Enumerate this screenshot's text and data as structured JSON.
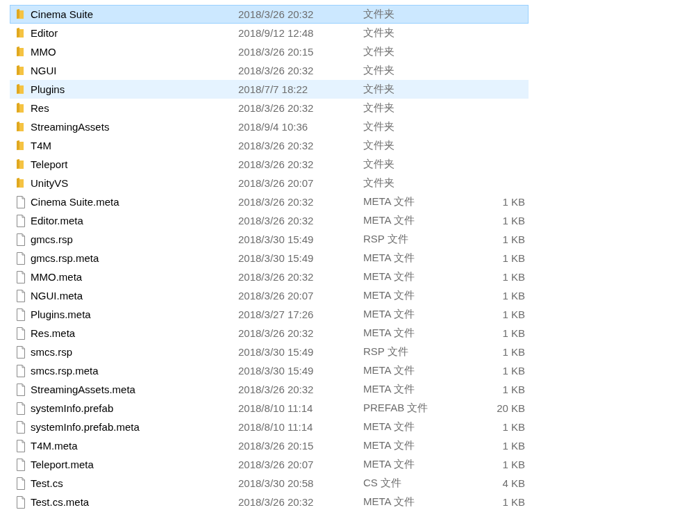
{
  "files": [
    {
      "kind": "folder",
      "name": "Cinema Suite",
      "modified": "2018/3/26 20:32",
      "type": "文件夹",
      "selected": true,
      "hovered": false
    },
    {
      "kind": "folder",
      "name": "Editor",
      "modified": "2018/9/12 12:48",
      "type": "文件夹",
      "selected": false,
      "hovered": false
    },
    {
      "kind": "folder",
      "name": "MMO",
      "modified": "2018/3/26 20:15",
      "type": "文件夹",
      "selected": false,
      "hovered": false
    },
    {
      "kind": "folder",
      "name": "NGUI",
      "modified": "2018/3/26 20:32",
      "type": "文件夹",
      "selected": false,
      "hovered": false
    },
    {
      "kind": "folder",
      "name": "Plugins",
      "modified": "2018/7/7 18:22",
      "type": "文件夹",
      "selected": false,
      "hovered": true
    },
    {
      "kind": "folder",
      "name": "Res",
      "modified": "2018/3/26 20:32",
      "type": "文件夹",
      "selected": false,
      "hovered": false
    },
    {
      "kind": "folder",
      "name": "StreamingAssets",
      "modified": "2018/9/4 10:36",
      "type": "文件夹",
      "selected": false,
      "hovered": false
    },
    {
      "kind": "folder",
      "name": "T4M",
      "modified": "2018/3/26 20:32",
      "type": "文件夹",
      "selected": false,
      "hovered": false
    },
    {
      "kind": "folder",
      "name": "Teleport",
      "modified": "2018/3/26 20:32",
      "type": "文件夹",
      "selected": false,
      "hovered": false
    },
    {
      "kind": "folder",
      "name": "UnityVS",
      "modified": "2018/3/26 20:07",
      "type": "文件夹",
      "selected": false,
      "hovered": false
    },
    {
      "kind": "file",
      "name": "Cinema Suite.meta",
      "modified": "2018/3/26 20:32",
      "type": "META 文件",
      "size": "1 KB",
      "selected": false,
      "hovered": false
    },
    {
      "kind": "file",
      "name": "Editor.meta",
      "modified": "2018/3/26 20:32",
      "type": "META 文件",
      "size": "1 KB",
      "selected": false,
      "hovered": false
    },
    {
      "kind": "file",
      "name": "gmcs.rsp",
      "modified": "2018/3/30 15:49",
      "type": "RSP 文件",
      "size": "1 KB",
      "selected": false,
      "hovered": false
    },
    {
      "kind": "file",
      "name": "gmcs.rsp.meta",
      "modified": "2018/3/30 15:49",
      "type": "META 文件",
      "size": "1 KB",
      "selected": false,
      "hovered": false
    },
    {
      "kind": "file",
      "name": "MMO.meta",
      "modified": "2018/3/26 20:32",
      "type": "META 文件",
      "size": "1 KB",
      "selected": false,
      "hovered": false
    },
    {
      "kind": "file",
      "name": "NGUI.meta",
      "modified": "2018/3/26 20:07",
      "type": "META 文件",
      "size": "1 KB",
      "selected": false,
      "hovered": false
    },
    {
      "kind": "file",
      "name": "Plugins.meta",
      "modified": "2018/3/27 17:26",
      "type": "META 文件",
      "size": "1 KB",
      "selected": false,
      "hovered": false
    },
    {
      "kind": "file",
      "name": "Res.meta",
      "modified": "2018/3/26 20:32",
      "type": "META 文件",
      "size": "1 KB",
      "selected": false,
      "hovered": false
    },
    {
      "kind": "file",
      "name": "smcs.rsp",
      "modified": "2018/3/30 15:49",
      "type": "RSP 文件",
      "size": "1 KB",
      "selected": false,
      "hovered": false
    },
    {
      "kind": "file",
      "name": "smcs.rsp.meta",
      "modified": "2018/3/30 15:49",
      "type": "META 文件",
      "size": "1 KB",
      "selected": false,
      "hovered": false
    },
    {
      "kind": "file",
      "name": "StreamingAssets.meta",
      "modified": "2018/3/26 20:32",
      "type": "META 文件",
      "size": "1 KB",
      "selected": false,
      "hovered": false
    },
    {
      "kind": "file",
      "name": "systemInfo.prefab",
      "modified": "2018/8/10 11:14",
      "type": "PREFAB 文件",
      "size": "20 KB",
      "selected": false,
      "hovered": false
    },
    {
      "kind": "file",
      "name": "systemInfo.prefab.meta",
      "modified": "2018/8/10 11:14",
      "type": "META 文件",
      "size": "1 KB",
      "selected": false,
      "hovered": false
    },
    {
      "kind": "file",
      "name": "T4M.meta",
      "modified": "2018/3/26 20:15",
      "type": "META 文件",
      "size": "1 KB",
      "selected": false,
      "hovered": false
    },
    {
      "kind": "file",
      "name": "Teleport.meta",
      "modified": "2018/3/26 20:07",
      "type": "META 文件",
      "size": "1 KB",
      "selected": false,
      "hovered": false
    },
    {
      "kind": "file",
      "name": "Test.cs",
      "modified": "2018/3/30 20:58",
      "type": "CS 文件",
      "size": "4 KB",
      "selected": false,
      "hovered": false
    },
    {
      "kind": "file",
      "name": "Test.cs.meta",
      "modified": "2018/3/26 20:32",
      "type": "META 文件",
      "size": "1 KB",
      "selected": false,
      "hovered": false
    }
  ]
}
